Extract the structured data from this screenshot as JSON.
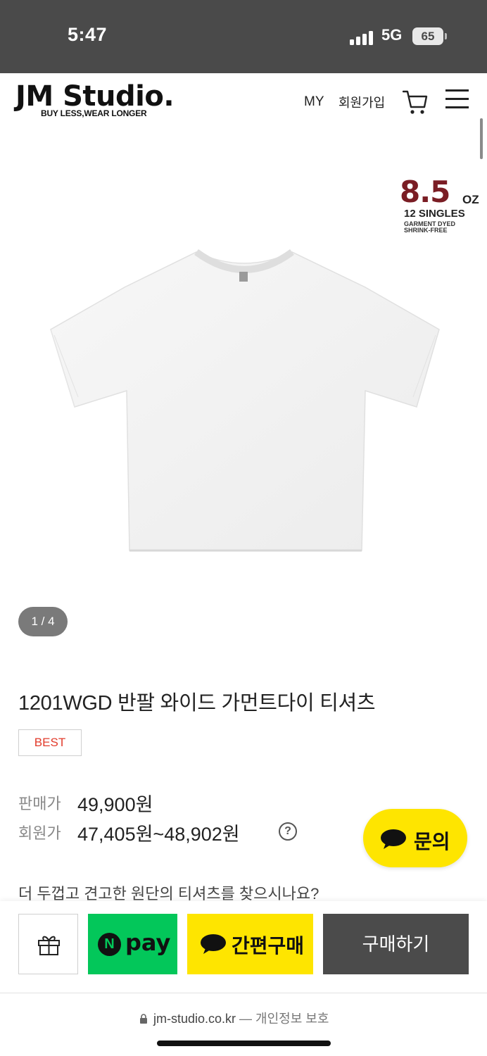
{
  "status_bar": {
    "time": "5:47",
    "network": "5G",
    "battery": "65"
  },
  "header": {
    "logo": "JM Studio.",
    "tagline": "BUY LESS,WEAR LONGER",
    "nav_my": "MY",
    "nav_join": "회원가입",
    "cart_icon": "cart-icon",
    "menu_icon": "hamburger-menu-icon"
  },
  "gallery": {
    "spec_weight": "8.5",
    "spec_unit": "OZ",
    "spec_singles": "12 SINGLES",
    "spec_dyed": "GARMENT DYED",
    "spec_shrink": "SHRINK-FREE",
    "pager": "1 / 4"
  },
  "product": {
    "title": "1201WGD 반팔 와이드 가먼트다이 티셔츠",
    "badge": "BEST",
    "sale_label": "판매가",
    "sale_price": "49,900원",
    "member_label": "회원가",
    "member_price": "47,405원~48,902원",
    "help": "?",
    "promo": "더 두껍고 견고한 원단의 티셔츠를 찾으시나요?"
  },
  "inquiry": {
    "label": "문의"
  },
  "actions": {
    "npay_n": "N",
    "npay_label": "pay",
    "kakao_label": "간편구매",
    "buy_label": "구매하기"
  },
  "browser": {
    "url": "jm-studio.co.kr",
    "secure_label": "— 개인정보 보호"
  },
  "colors": {
    "status_bar": "#4a4a4a",
    "npay_green": "#03c75a",
    "kakao_yellow": "#fee500",
    "buy_dark": "#4b4b4b",
    "best_red": "#e23b2b",
    "spec_maroon": "#7a1d24"
  }
}
